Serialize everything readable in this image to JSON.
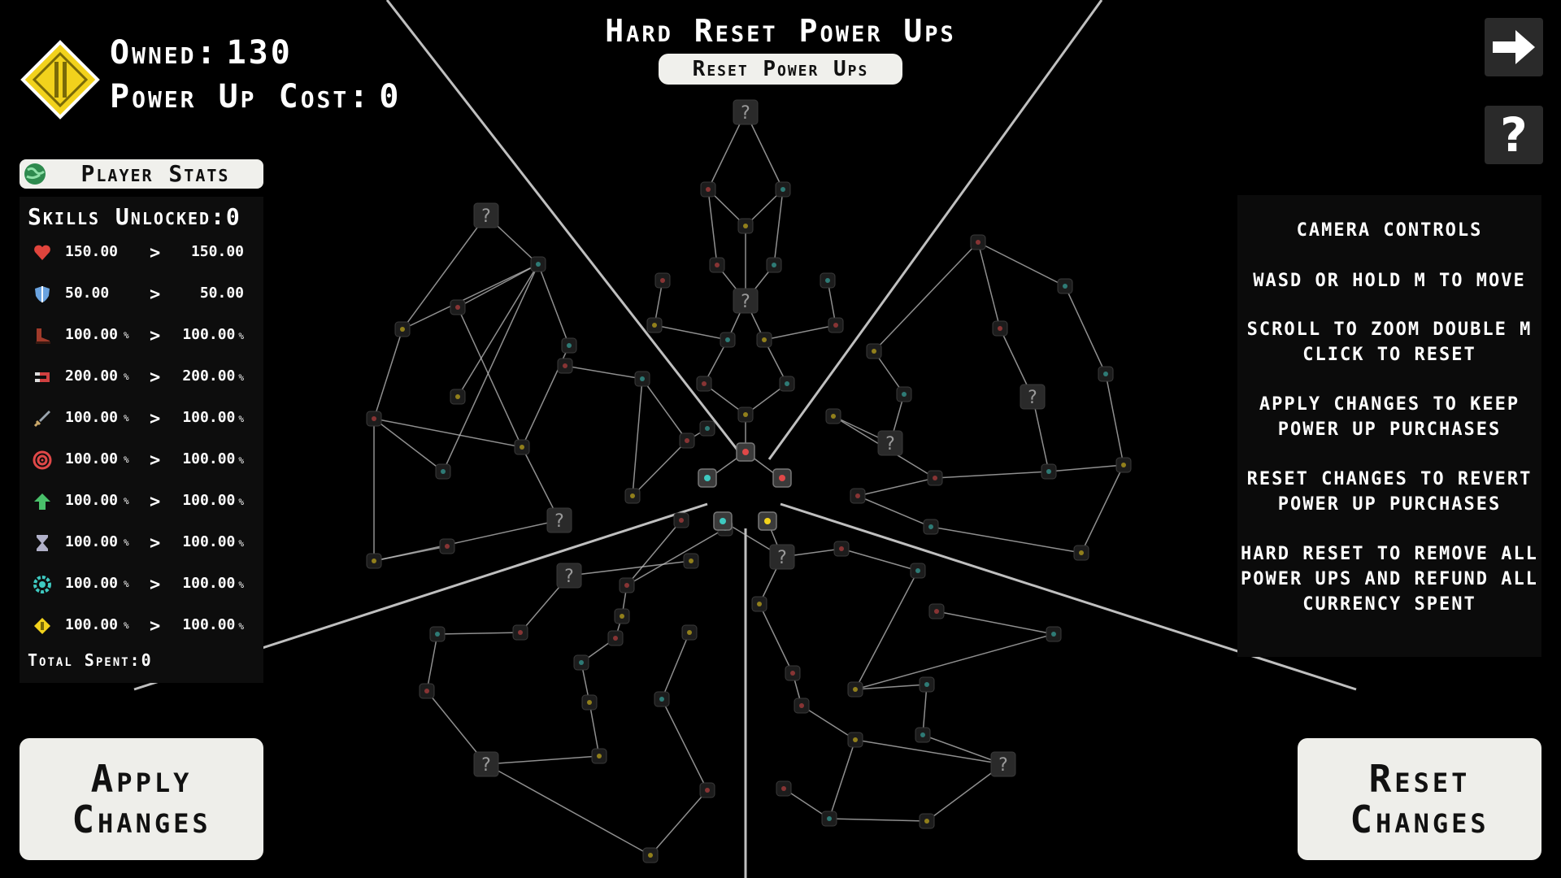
{
  "header": {
    "owned_label": "Owned:",
    "owned_value": "130",
    "cost_label": "Power Up Cost:",
    "cost_value": "0",
    "title": "Hard Reset Power Ups",
    "reset_power_ups_label": "Reset Power Ups"
  },
  "icons": {
    "currency": "yellow-diamond-coin-icon",
    "next": "arrow-right-icon",
    "help": "question-mark-icon",
    "globe": "globe-icon"
  },
  "help_label": "?",
  "stats": {
    "header_label": "Player Stats",
    "skills_unlocked": "Skills Unlocked:0",
    "rows": [
      {
        "icon": "heart-icon",
        "color": "#e0443c",
        "before": "150.00",
        "after": "150.00",
        "unit": ""
      },
      {
        "icon": "shield-icon",
        "color": "#6aa3e0",
        "before": "50.00",
        "after": "50.00",
        "unit": ""
      },
      {
        "icon": "boot-icon",
        "color": "#a03a2a",
        "before": "100.00",
        "after": "100.00",
        "unit": "%"
      },
      {
        "icon": "magnet-icon",
        "color": "#d04040",
        "before": "200.00",
        "after": "200.00",
        "unit": "%"
      },
      {
        "icon": "sword-icon",
        "color": "#9aa4ae",
        "before": "100.00",
        "after": "100.00",
        "unit": "%"
      },
      {
        "icon": "target-icon",
        "color": "#e04848",
        "before": "100.00",
        "after": "100.00",
        "unit": "%"
      },
      {
        "icon": "arrow-up-icon",
        "color": "#49c06a",
        "before": "100.00",
        "after": "100.00",
        "unit": "%"
      },
      {
        "icon": "hourglass-icon",
        "color": "#b0b0c8",
        "before": "100.00",
        "after": "100.00",
        "unit": "%"
      },
      {
        "icon": "gear-icon",
        "color": "#3ec9c0",
        "before": "100.00",
        "after": "100.00",
        "unit": "%"
      },
      {
        "icon": "coin-icon",
        "color": "#f2d21c",
        "before": "100.00",
        "after": "100.00",
        "unit": "%"
      }
    ],
    "separator": ">",
    "total_spent": "Total Spent:0"
  },
  "camera": {
    "lines": [
      "CAMERA CONTROLS",
      "WASD OR HOLD M TO MOVE",
      "SCROLL TO ZOOM DOUBLE M",
      "CLICK TO RESET",
      "APPLY CHANGES TO KEEP",
      "POWER UP PURCHASES",
      "RESET CHANGES TO REVERT",
      "POWER UP PURCHASES",
      "HARD RESET TO REMOVE ALL",
      "POWER UPS AND REFUND ALL",
      "CURRENCY SPENT"
    ]
  },
  "buttons": {
    "apply_line1": "Apply",
    "apply_line2": "Changes",
    "reset_line1": "Reset",
    "reset_line2": "Changes"
  },
  "tree": {
    "locked_label": "?",
    "colors": {
      "edge": "#bfbfbf",
      "node": "#2a2a2a",
      "node_dim": "#1c1c1c",
      "accent_red": "#e04848",
      "accent_yellow": "#f2d21c",
      "accent_teal": "#3ec9c0"
    }
  }
}
